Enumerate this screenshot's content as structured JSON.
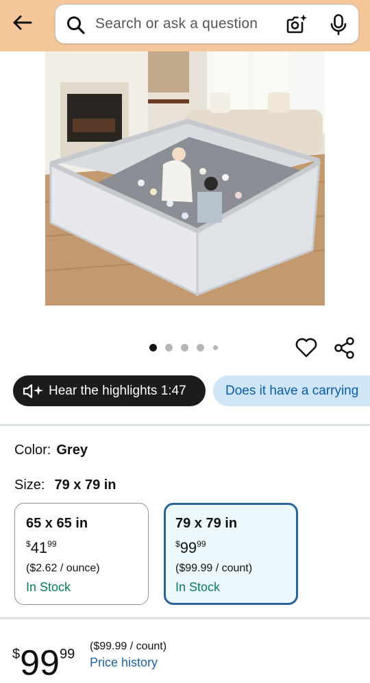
{
  "search": {
    "placeholder": "Search or ask a question"
  },
  "icons": {
    "back": "arrow-left-icon",
    "search": "search-icon",
    "camera": "camera-icon",
    "mic": "microphone-icon",
    "heart": "heart-icon",
    "share": "share-icon",
    "speaker": "speaker-sparkle-icon"
  },
  "carousel": {
    "count": 5,
    "active": 0
  },
  "chips": {
    "hear": "Hear the highlights 1:47",
    "ask": "Does it have a carrying"
  },
  "color": {
    "label": "Color:",
    "value": "Grey"
  },
  "size": {
    "label": "Size:",
    "value": "79 x 79 in"
  },
  "options": [
    {
      "title": "65 x 65 in",
      "dollars": "41",
      "cents": "99",
      "currency": "$",
      "unit": "($2.62 / ounce)",
      "stock": "In Stock",
      "selected": false
    },
    {
      "title": "79 x 79 in",
      "dollars": "99",
      "cents": "99",
      "currency": "$",
      "unit": "($99.99 / count)",
      "stock": "In Stock",
      "selected": true
    }
  ],
  "price": {
    "currency": "$",
    "dollars": "99",
    "cents": "99",
    "unit": "($99.99 / count)",
    "history": "Price history"
  },
  "colors": {
    "topbar": "#f5c69a",
    "stock": "#067d62",
    "link": "#2162a1",
    "selected_border": "#2a6496",
    "chip_blue": "#cfe6f8"
  }
}
